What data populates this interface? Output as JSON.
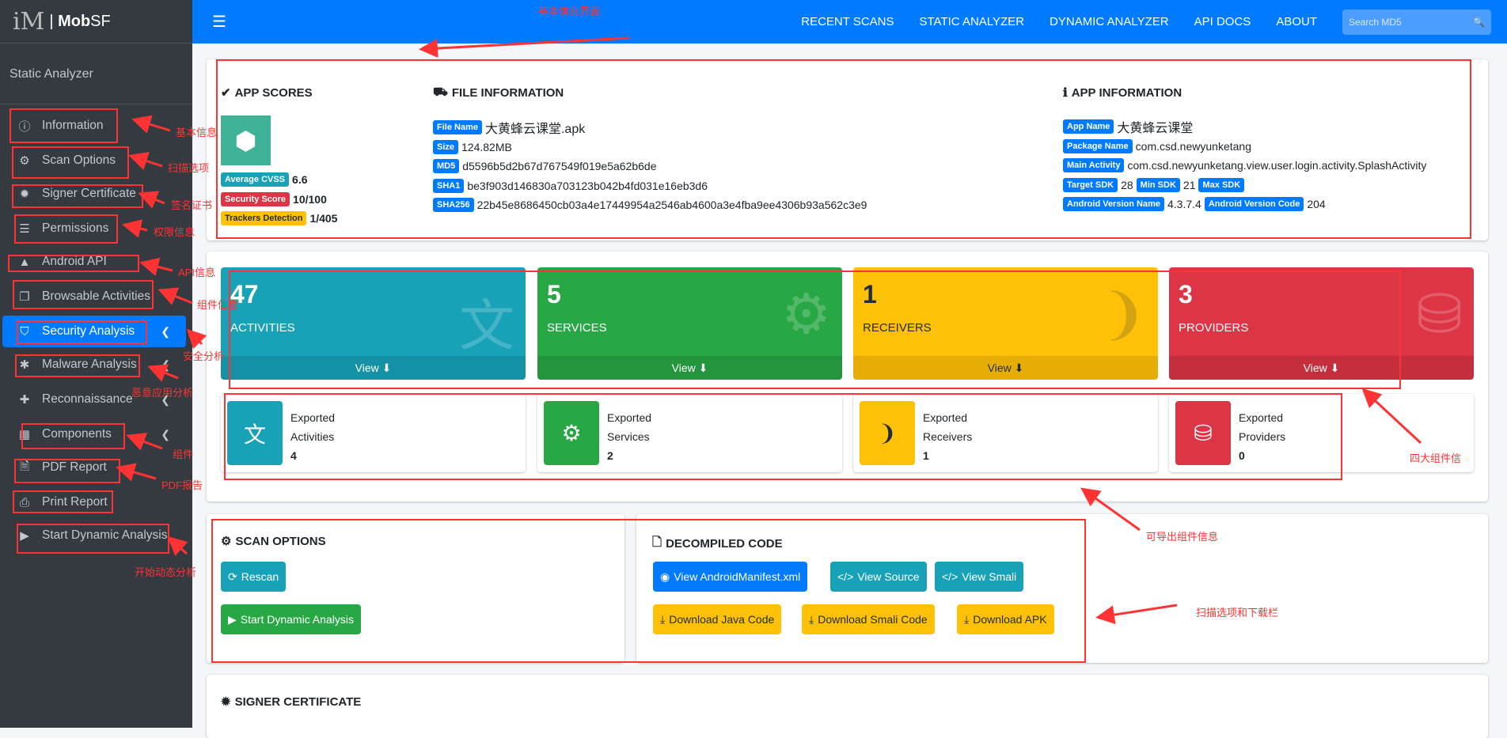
{
  "brand": {
    "name_bold": "Mob",
    "name_rest": "SF"
  },
  "sidebar": {
    "section": "Static Analyzer",
    "items": [
      {
        "label": "Information",
        "icon": "info-circle-icon"
      },
      {
        "label": "Scan Options",
        "icon": "gear-icon"
      },
      {
        "label": "Signer Certificate",
        "icon": "certificate-icon"
      },
      {
        "label": "Permissions",
        "icon": "list-icon"
      },
      {
        "label": "Android API",
        "icon": "android-icon"
      },
      {
        "label": "Browsable Activities",
        "icon": "clone-icon"
      },
      {
        "label": "Security Analysis",
        "icon": "shield-icon"
      },
      {
        "label": "Malware Analysis",
        "icon": "bug-icon"
      },
      {
        "label": "Reconnaissance",
        "icon": "plus-icon"
      },
      {
        "label": "Components",
        "icon": "grid-icon"
      },
      {
        "label": "PDF Report",
        "icon": "file-pdf-icon"
      },
      {
        "label": "Print Report",
        "icon": "print-icon"
      },
      {
        "label": "Start Dynamic Analysis",
        "icon": "play-circle-icon"
      }
    ]
  },
  "topnav": {
    "links": [
      "RECENT SCANS",
      "STATIC ANALYZER",
      "DYNAMIC ANALYZER",
      "API DOCS",
      "ABOUT"
    ],
    "search_placeholder": "Search MD5"
  },
  "app_scores": {
    "title": "APP SCORES",
    "cvss_label": "Average CVSS",
    "cvss": "6.6",
    "security_label": "Security Score",
    "security": "10/100",
    "trackers_label": "Trackers Detection",
    "trackers": "1/405"
  },
  "file_info": {
    "title": "FILE INFORMATION",
    "rows": [
      {
        "label": "File Name",
        "value": "大黄蜂云课堂.apk"
      },
      {
        "label": "Size",
        "value": "124.82MB"
      },
      {
        "label": "MD5",
        "value": "d5596b5d2b67d767549f019e5a62b6de"
      },
      {
        "label": "SHA1",
        "value": "be3f903d146830a703123b042b4fd031e16eb3d6"
      },
      {
        "label": "SHA256",
        "value": "22b45e8686450cb03a4e17449954a2546ab4600a3e4fba9ee4306b93a562c3e9"
      }
    ]
  },
  "app_info": {
    "title": "APP INFORMATION",
    "app_name_label": "App Name",
    "app_name": "大黄蜂云课堂",
    "package_label": "Package Name",
    "package": "com.csd.newyunketang",
    "main_activity_label": "Main Activity",
    "main_activity": "com.csd.newyunketang.view.user.login.activity.SplashActivity",
    "target_sdk_label": "Target SDK",
    "target_sdk": "28",
    "min_sdk_label": "Min SDK",
    "min_sdk": "21",
    "max_sdk_label": "Max SDK",
    "version_name_label": "Android Version Name",
    "version_name": "4.3.7.4",
    "version_code_label": "Android Version Code",
    "version_code": "204"
  },
  "tiles": [
    {
      "count": "47",
      "label": "ACTIVITIES",
      "view": "View",
      "color": "#17a2b8"
    },
    {
      "count": "5",
      "label": "SERVICES",
      "view": "View",
      "color": "#28a745"
    },
    {
      "count": "1",
      "label": "RECEIVERS",
      "view": "View",
      "color": "#ffc107"
    },
    {
      "count": "3",
      "label": "PROVIDERS",
      "view": "View",
      "color": "#dc3545"
    }
  ],
  "exported": [
    {
      "line1": "Exported",
      "line2": "Activities",
      "count": "4"
    },
    {
      "line1": "Exported",
      "line2": "Services",
      "count": "2"
    },
    {
      "line1": "Exported",
      "line2": "Receivers",
      "count": "1"
    },
    {
      "line1": "Exported",
      "line2": "Providers",
      "count": "0"
    }
  ],
  "scan_options": {
    "title": "SCAN OPTIONS",
    "rescan": "Rescan",
    "start_dynamic": "Start Dynamic Analysis"
  },
  "decompiled": {
    "title": "DECOMPILED CODE",
    "view_manifest": "View AndroidManifest.xml",
    "view_source": "View Source",
    "view_smali": "View Smali",
    "download_java": "Download Java Code",
    "download_smali": "Download Smali Code",
    "download_apk": "Download APK"
  },
  "signer": {
    "title": "SIGNER CERTIFICATE"
  },
  "annotations": {
    "top": "基本信息界面",
    "information": "基本信息",
    "scan_options": "扫描选项",
    "signer": "签名证书",
    "permissions": "权限信息",
    "api": "API信息",
    "browsable": "组件信息",
    "security": "安全分析",
    "malware": "恶意应用分析",
    "components": "组件",
    "pdf": "PDF报告",
    "dynamic": "开始动态分析",
    "four_components": "四大组件信",
    "exportable": "可导出组件信息",
    "scan_download": "扫描选项和下载栏"
  }
}
